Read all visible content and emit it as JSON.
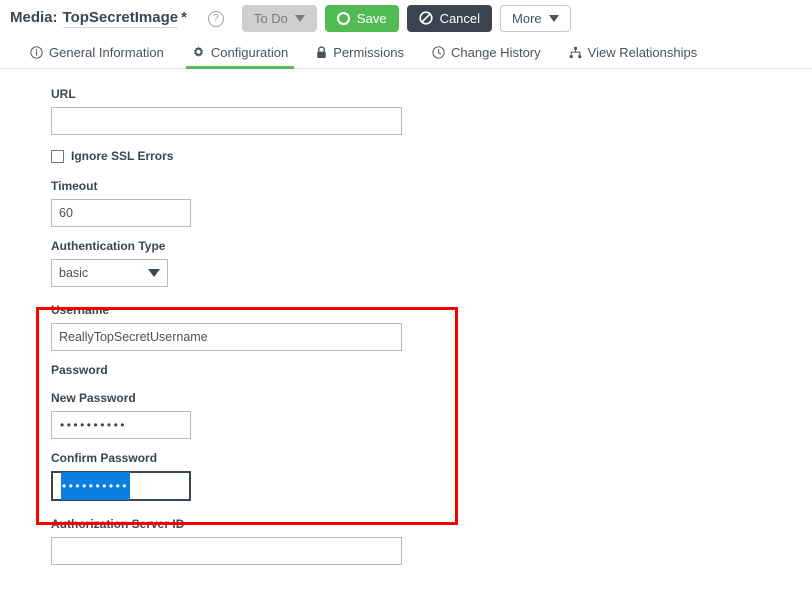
{
  "header": {
    "title_prefix": "Media:",
    "title_name": "TopSecretImage",
    "title_modified_marker": "*",
    "help_icon": "help-circle-icon",
    "buttons": {
      "todo_label": "To Do",
      "save_label": "Save",
      "cancel_label": "Cancel",
      "more_label": "More"
    },
    "colors": {
      "save_green": "#53bb53",
      "cancel_dark": "#3b4450",
      "todo_gray": "#cfcfcf"
    }
  },
  "tabs": [
    {
      "label": "General Information",
      "icon": "info-circle-icon",
      "active": false
    },
    {
      "label": "Configuration",
      "icon": "gear-icon",
      "active": true
    },
    {
      "label": "Permissions",
      "icon": "lock-icon",
      "active": false
    },
    {
      "label": "Change History",
      "icon": "clock-icon",
      "active": false
    },
    {
      "label": "View Relationships",
      "icon": "sitemap-icon",
      "active": false
    }
  ],
  "tab_accent_color": "#5cb85c",
  "form": {
    "url": {
      "label": "URL",
      "value": "",
      "placeholder": ""
    },
    "ignore_ssl": {
      "label": "Ignore SSL Errors",
      "checked": false
    },
    "timeout": {
      "label": "Timeout",
      "value": "60"
    },
    "auth_type": {
      "label": "Authentication Type",
      "value": "basic",
      "options": [
        "basic"
      ]
    },
    "username": {
      "label": "Username",
      "value": "ReallyTopSecretUsername"
    },
    "password_group_label": "Password",
    "new_password": {
      "label": "New Password",
      "value": "••••••••••",
      "masked_char_count": 10
    },
    "confirm_password": {
      "label": "Confirm Password",
      "value": "••••••••••",
      "masked_char_count": 10,
      "focused": true,
      "text_selected": true,
      "selection_color": "#0b7fe0"
    },
    "authorization_server_id": {
      "label": "Authorization Server ID",
      "value": ""
    }
  },
  "annotation": {
    "type": "highlight-rectangle",
    "color": "#f50000"
  }
}
